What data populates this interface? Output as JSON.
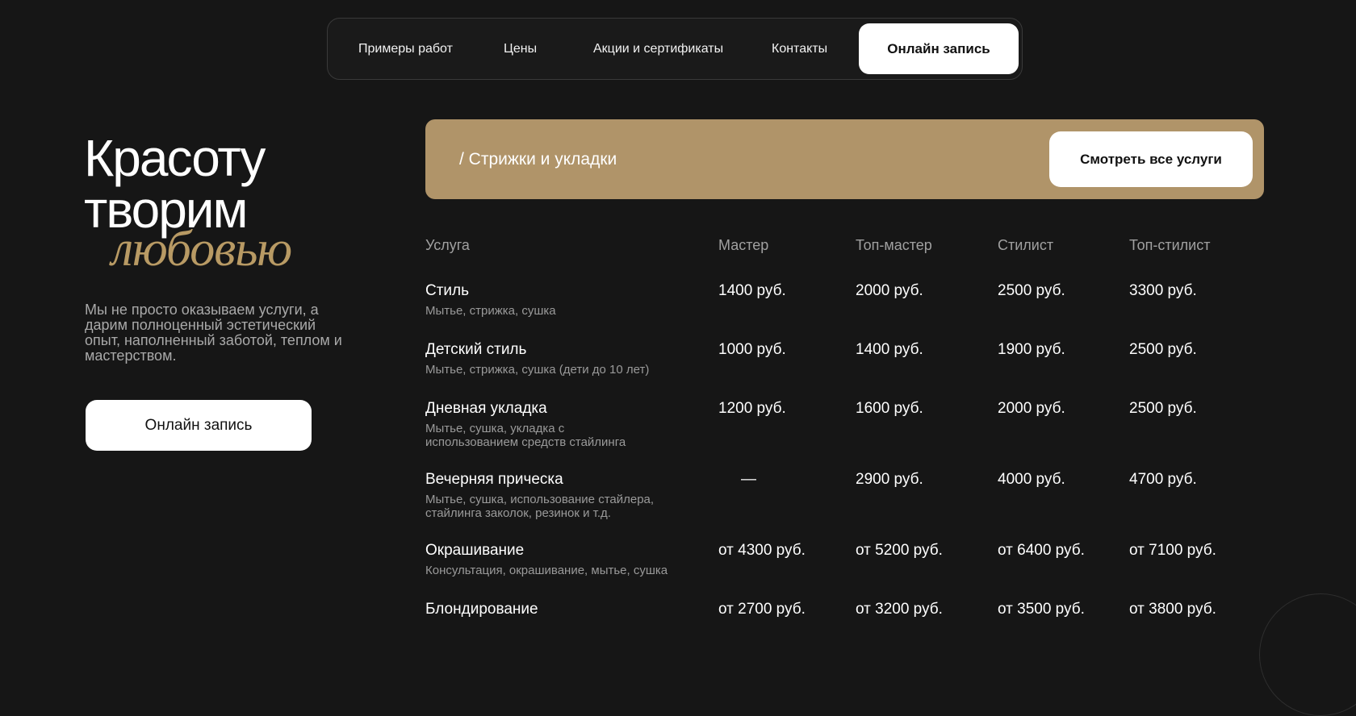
{
  "nav": {
    "items": [
      "Примеры работ",
      "Цены",
      "Акции и сертификаты",
      "Контакты"
    ],
    "cta": "Онлайн запись"
  },
  "hero": {
    "line1": "Красоту",
    "line2": "творим",
    "accent": "любовью",
    "description": "Мы не просто оказываем услуги, а дарим полноценный эстетический опыт, наполненный заботой, теплом и мастерством.",
    "button": "Онлайн запись"
  },
  "category": {
    "title": "/ Стрижки и укладки",
    "button": "Смотреть все услуги"
  },
  "table": {
    "headers": [
      "Услуга",
      "Мастер",
      "Топ-мастер",
      "Стилист",
      "Топ-стилист"
    ],
    "rows": [
      {
        "name": "Стиль",
        "desc": "Мытье, стрижка, сушка",
        "prices": [
          "1400 руб.",
          "2000 руб.",
          "2500 руб.",
          "3300 руб."
        ]
      },
      {
        "name": "Детский стиль",
        "desc": "Мытье, стрижка, сушка (дети до 10 лет)",
        "prices": [
          "1000 руб.",
          "1400 руб.",
          "1900 руб.",
          "2500 руб."
        ]
      },
      {
        "name": "Дневная укладка",
        "desc": "Мытье, сушка, укладка с использованием средств стайлинга",
        "prices": [
          "1200 руб.",
          "1600 руб.",
          "2000 руб.",
          "2500 руб."
        ]
      },
      {
        "name": "Вечерняя прическа",
        "desc": "Мытье, сушка, использование стайлера, стайлинга заколок, резинок и т.д.",
        "prices": [
          "—",
          "2900 руб.",
          "4000 руб.",
          "4700 руб."
        ]
      },
      {
        "name": "Окрашивание",
        "desc": "Консультация, окрашивание, мытье, сушка",
        "prices": [
          "от 4300 руб.",
          "от 5200 руб.",
          "от 6400 руб.",
          "от 7100 руб."
        ]
      },
      {
        "name": "Блондирование",
        "desc": "",
        "prices": [
          "от 2700 руб.",
          "от 3200 руб.",
          "от 3500 руб.",
          "от 3800 руб."
        ]
      }
    ]
  },
  "colors": {
    "background": "#161616",
    "accent": "#b09469",
    "button_bg": "#ffffff"
  }
}
